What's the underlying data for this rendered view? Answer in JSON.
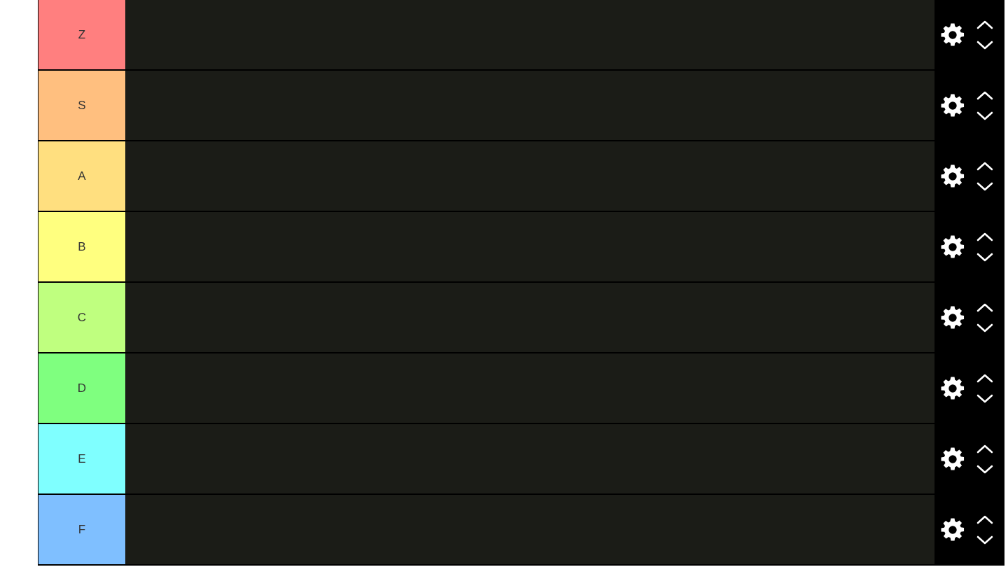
{
  "tiers": [
    {
      "label": "Z",
      "color": "#ff7f7f"
    },
    {
      "label": "S",
      "color": "#ffbf7f"
    },
    {
      "label": "A",
      "color": "#ffdf7f"
    },
    {
      "label": "B",
      "color": "#ffff7f"
    },
    {
      "label": "C",
      "color": "#bfff7f"
    },
    {
      "label": "D",
      "color": "#7fff7f"
    },
    {
      "label": "E",
      "color": "#7fffff"
    },
    {
      "label": "F",
      "color": "#7fbfff"
    }
  ]
}
